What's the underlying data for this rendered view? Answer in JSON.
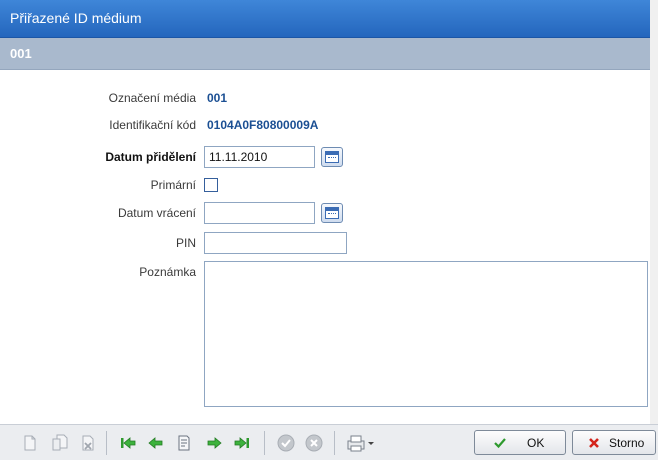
{
  "window": {
    "title": "Přiřazené ID médium"
  },
  "subheader": {
    "text": "001"
  },
  "form": {
    "oznaceni_label": "Označení média",
    "oznaceni_value": "001",
    "kod_label": "Identifikační kód",
    "kod_value": "0104A0F80800009A",
    "datum_prideleni_label": "Datum přidělení",
    "datum_prideleni_value": "11.11.2010",
    "primarni_label": "Primární",
    "primarni_checked": false,
    "datum_vraceni_label": "Datum vrácení",
    "datum_vraceni_value": "",
    "pin_label": "PIN",
    "pin_value": "",
    "poznamka_label": "Poznámka",
    "poznamka_value": ""
  },
  "toolbar": {
    "ok_label": "OK",
    "storno_label": "Storno"
  },
  "colors": {
    "titlebar": "#2f73c9",
    "subheader": "#a9b9cd",
    "value_text": "#1b4f93",
    "nav_arrow": "#2e9a2e",
    "storno_x": "#d4241b"
  }
}
